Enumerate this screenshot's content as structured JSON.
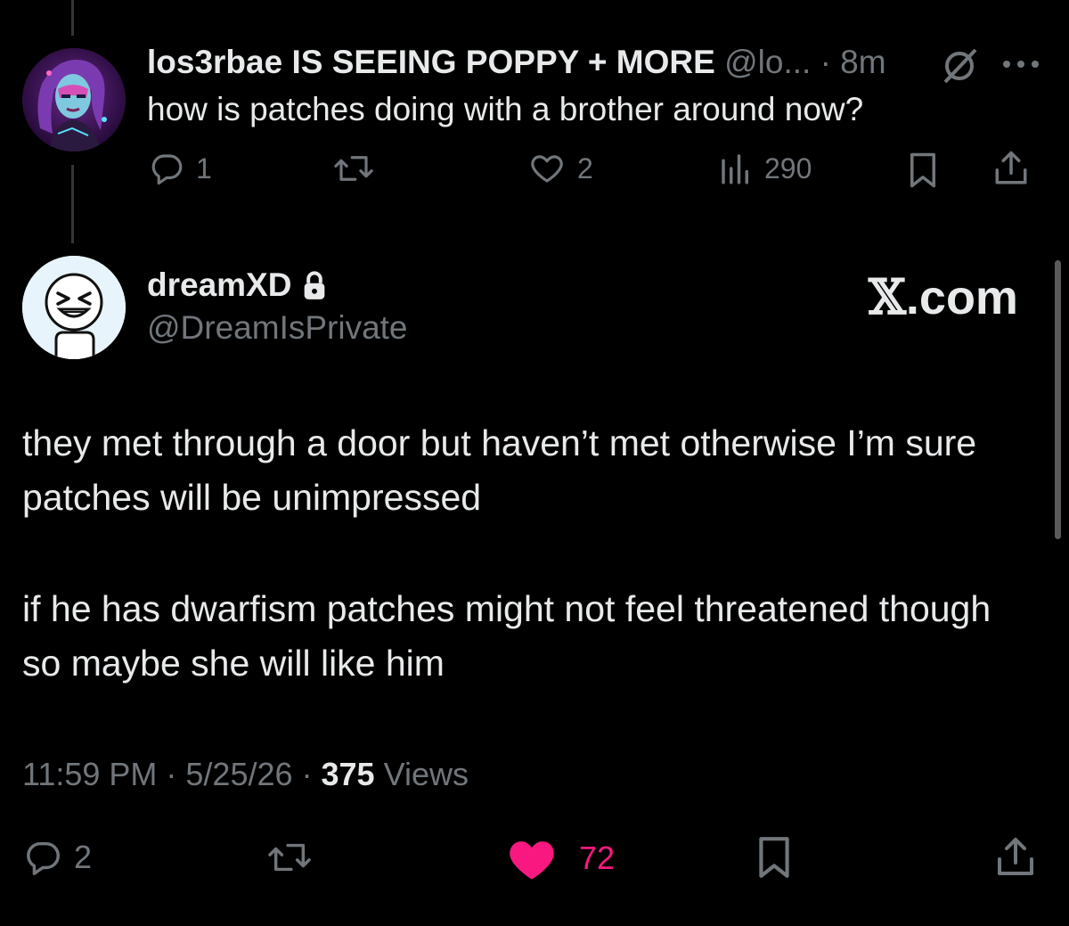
{
  "reply": {
    "name": "los3rbae IS SEEING POPPY + MORE",
    "handle": "@lo...",
    "time": "· 8m",
    "text": "how is patches doing with a brother around now?",
    "replies": "1",
    "likes": "2",
    "views": "290"
  },
  "main": {
    "name": "dreamXD",
    "handle": "@DreamIsPrivate",
    "watermark_x": "𝕏",
    "watermark_rest": ".com",
    "paragraph1": "they met through a door but haven’t met otherwise I’m sure patches will be unimpressed",
    "paragraph2": "if he has dwarfism patches might not feel threatened though so maybe she will like him",
    "meta_time": "11:59 PM · 5/25/26 · ",
    "meta_views_count": "375",
    "meta_views_label": " Views",
    "replies": "2",
    "likes": "72",
    "like_color": "#f91880"
  },
  "icons": [
    "reply-icon",
    "retweet-icon",
    "like-icon",
    "views-icon",
    "bookmark-icon",
    "share-icon",
    "grok-icon",
    "more-icon",
    "lock-icon"
  ]
}
